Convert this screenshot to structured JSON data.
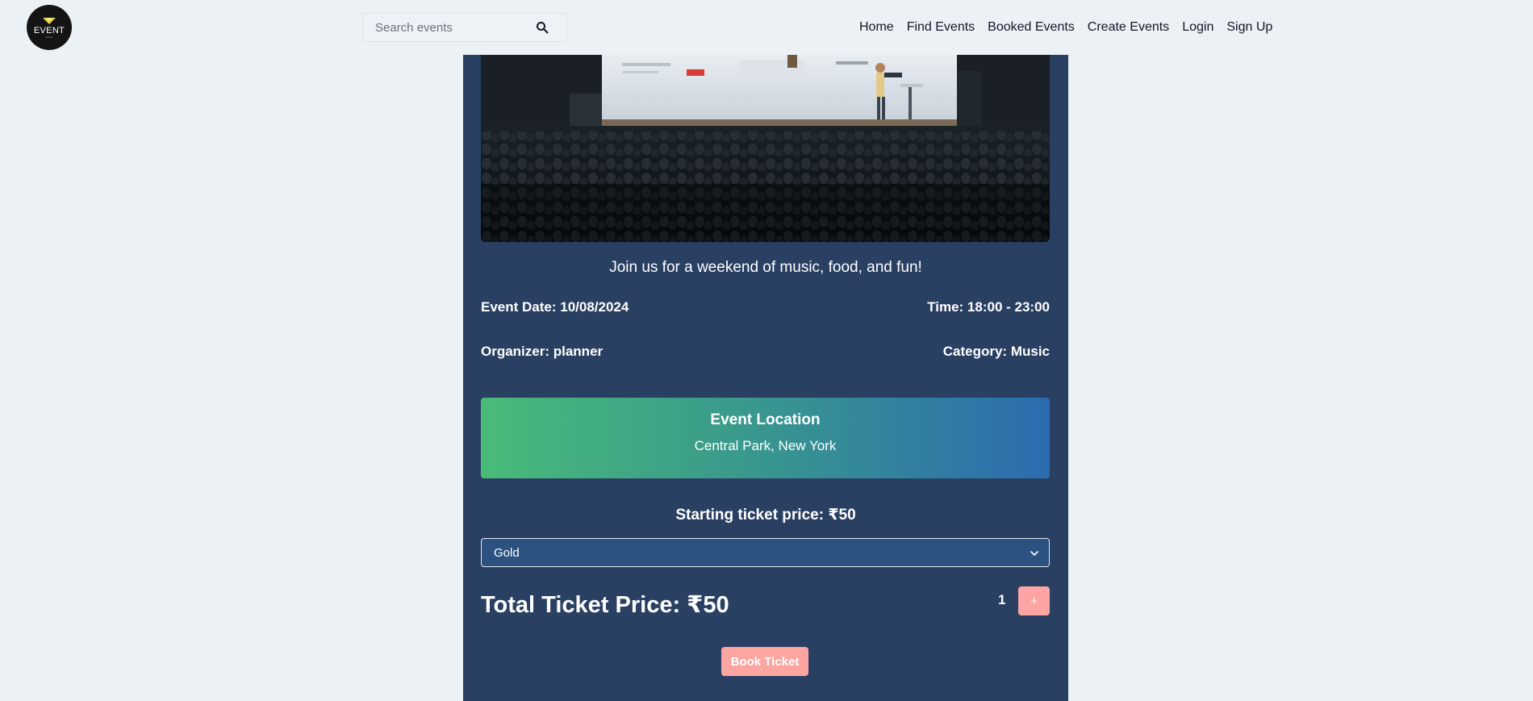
{
  "header": {
    "logo": {
      "text": "EVENT",
      "subtext": "planner"
    },
    "search": {
      "placeholder": "Search events",
      "icon": "search-icon"
    },
    "nav": [
      {
        "label": "Home"
      },
      {
        "label": "Find Events"
      },
      {
        "label": "Booked Events"
      },
      {
        "label": "Create Events"
      },
      {
        "label": "Login"
      },
      {
        "label": "Sign Up"
      }
    ]
  },
  "event": {
    "image_icon": "conference-photo",
    "description": "Join us for a weekend of music, food, and fun!",
    "date_text": "Event Date: 10/08/2024",
    "time_text": "Time: 18:00 - 23:00",
    "organizer_text": "Organizer: planner",
    "category_text": "Category: Music",
    "location": {
      "title": "Event Location",
      "value": "Central Park, New York"
    },
    "starting_price_text": "Starting ticket price: ₹50",
    "ticket_select": {
      "selected": "Gold",
      "icon": "chevron-down-icon"
    },
    "total_text": "Total Ticket Price: ₹50",
    "quantity": "1",
    "increment_label": "+",
    "book_label": "Book Ticket"
  },
  "colors": {
    "page_bg": "#ecf1f6",
    "card_bg": "#294063",
    "select_bg": "#2c5282",
    "gradient_start": "#48bb78",
    "gradient_end": "#2b6cb0",
    "button_bg": "#fca5a1"
  }
}
